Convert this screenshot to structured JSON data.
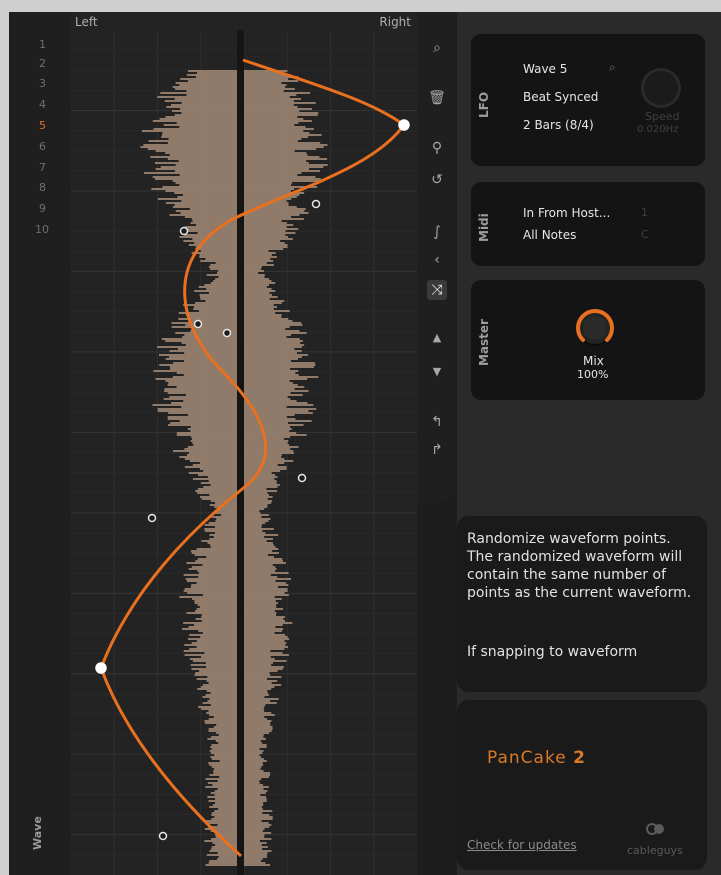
{
  "editor": {
    "left_label": "Left",
    "right_label": "Right",
    "wave_label": "Wave",
    "numbers": [
      "1",
      "2",
      "3",
      "4",
      "5",
      "6",
      "7",
      "8",
      "9",
      "10"
    ],
    "active_number": "5"
  },
  "toolbar": {
    "tools": [
      {
        "name": "zoom-tool",
        "icon": "search-icon"
      },
      {
        "name": "delete-tool",
        "icon": "trash-icon"
      },
      {
        "name": "link-tool",
        "icon": "link-icon"
      },
      {
        "name": "curve-tool",
        "icon": "curve-icon"
      },
      {
        "name": "smooth-tool",
        "icon": "s-curve-icon"
      },
      {
        "name": "mirror-tool",
        "icon": "chevron-left-icon"
      },
      {
        "name": "randomize-tool",
        "icon": "shuffle-icon"
      },
      {
        "name": "move-up-tool",
        "icon": "triangle-up-icon"
      },
      {
        "name": "move-down-tool",
        "icon": "triangle-down-icon"
      },
      {
        "name": "undo-tool",
        "icon": "undo-icon"
      },
      {
        "name": "redo-tool",
        "icon": "redo-icon"
      }
    ]
  },
  "lfo": {
    "title": "LFO",
    "wave": "Wave 5",
    "sync": "Beat Synced",
    "length": "2 Bars (8/4)",
    "speed_label": "Speed",
    "speed_value": "0.020Hz"
  },
  "midi": {
    "title": "Midi",
    "input": "In From Host...",
    "input_channel": "1",
    "notes": "All Notes",
    "notes_key": "C"
  },
  "master": {
    "title": "Master",
    "mix_label": "Mix",
    "mix_value": "100%",
    "mix_fraction": 1.0
  },
  "help": {
    "text": "Randomize waveform points. The randomized waveform will contain the same number of points as the current waveform.",
    "text2": "If snapping to waveform"
  },
  "brand": {
    "product": "PanCake",
    "version": "2",
    "check_updates": "Check for updates",
    "vendor": "cableguys"
  },
  "colors": {
    "accent": "#e8701f",
    "background": "#1d1d1d",
    "panel": "#141414",
    "waveform_fill": "#a38a77"
  }
}
